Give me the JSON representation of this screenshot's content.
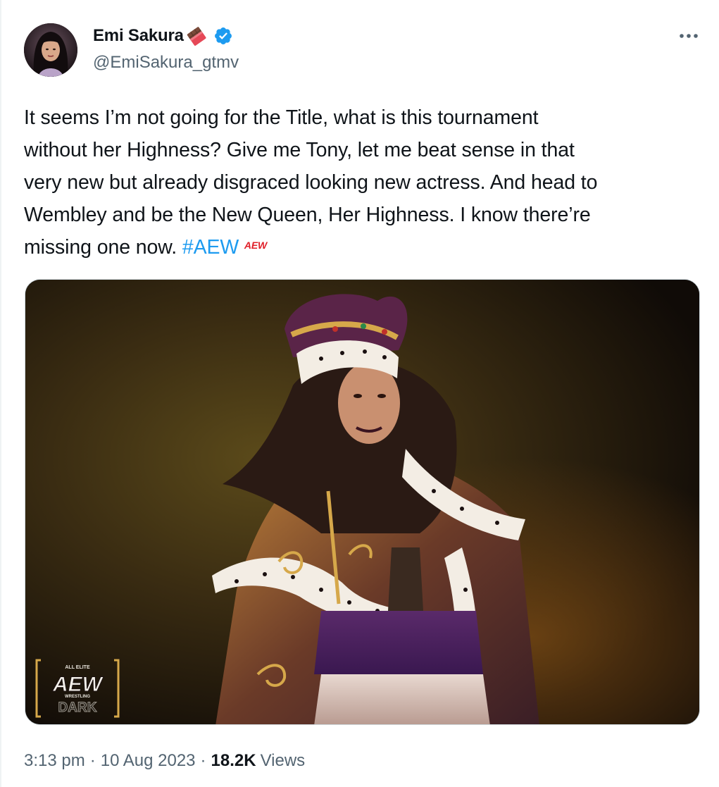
{
  "author": {
    "display_name": "Emi Sakura",
    "handle": "@EmiSakura_gtmv",
    "verified": true,
    "name_emoji": "chocolate-bar-icon"
  },
  "tweet": {
    "lines": [
      "It seems I’m not going for the Title, what is this tournament",
      "without her Highness? Give me Tony, let me beat sense in that",
      "very new but already disgraced looking new actress. And head to",
      "Wembley and be the New Queen, Her Highness. I know there’re",
      "missing one now. "
    ],
    "hashtag": "#AEW",
    "hashtag_emoji_text": "AEW"
  },
  "media": {
    "logo_top": "ALL ELITE",
    "logo_main": "AEW",
    "logo_sub": "WRESTLING",
    "logo_bottom": "DARK"
  },
  "meta": {
    "time": "3:13 pm",
    "date": "10 Aug 2023",
    "views_count": "18.2K",
    "views_label": "Views"
  },
  "colors": {
    "link": "#1d9bf0",
    "secondary_text": "#536471",
    "verified_badge": "#1d9bf0"
  }
}
